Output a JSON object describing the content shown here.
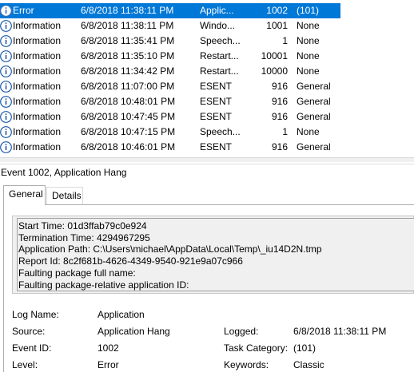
{
  "events": [
    {
      "level": "Error",
      "date": "6/8/2018 11:38:11 PM",
      "source": "Applic...",
      "id": "1002",
      "task": "(101)",
      "icon": "error-icon",
      "selected": true
    },
    {
      "level": "Information",
      "date": "6/8/2018 11:38:11 PM",
      "source": "Windo...",
      "id": "1001",
      "task": "None",
      "icon": "info-icon"
    },
    {
      "level": "Information",
      "date": "6/8/2018 11:35:41 PM",
      "source": "Speech...",
      "id": "1",
      "task": "None",
      "icon": "info-icon"
    },
    {
      "level": "Information",
      "date": "6/8/2018 11:35:10 PM",
      "source": "Restart...",
      "id": "10001",
      "task": "None",
      "icon": "info-icon"
    },
    {
      "level": "Information",
      "date": "6/8/2018 11:34:42 PM",
      "source": "Restart...",
      "id": "10000",
      "task": "None",
      "icon": "info-icon"
    },
    {
      "level": "Information",
      "date": "6/8/2018 11:07:00 PM",
      "source": "ESENT",
      "id": "916",
      "task": "General",
      "icon": "info-icon"
    },
    {
      "level": "Information",
      "date": "6/8/2018 10:48:01 PM",
      "source": "ESENT",
      "id": "916",
      "task": "General",
      "icon": "info-icon"
    },
    {
      "level": "Information",
      "date": "6/8/2018 10:47:45 PM",
      "source": "ESENT",
      "id": "916",
      "task": "General",
      "icon": "info-icon"
    },
    {
      "level": "Information",
      "date": "6/8/2018 10:47:15 PM",
      "source": "Speech...",
      "id": "1",
      "task": "None",
      "icon": "info-icon"
    },
    {
      "level": "Information",
      "date": "6/8/2018 10:46:01 PM",
      "source": "ESENT",
      "id": "916",
      "task": "General",
      "icon": "info-icon"
    }
  ],
  "detail": {
    "title": "Event 1002, Application Hang",
    "tabs": [
      "General",
      "Details"
    ],
    "description": [
      "Start Time: 01d3ffab79c0e924",
      "Termination Time: 4294967295",
      "Application Path: C:\\Users\\michael\\AppData\\Local\\Temp\\_iu14D2N.tmp",
      "Report Id: 8c2f681b-4626-4349-9540-921e9a07c966",
      "Faulting package full name:",
      "Faulting package-relative application ID:"
    ],
    "fields": {
      "log_name_label": "Log Name:",
      "log_name_value": "Application",
      "source_label": "Source:",
      "source_value": "Application Hang",
      "logged_label": "Logged:",
      "logged_value": "6/8/2018 11:38:11 PM",
      "event_id_label": "Event ID:",
      "event_id_value": "1002",
      "task_category_label": "Task Category:",
      "task_category_value": "(101)",
      "level_label": "Level:",
      "level_value": "Error",
      "keywords_label": "Keywords:",
      "keywords_value": "Classic"
    }
  },
  "colors": {
    "selection": "#0078d7",
    "info_icon": "#1e5aa8",
    "error_icon": "#3b6fb6"
  }
}
